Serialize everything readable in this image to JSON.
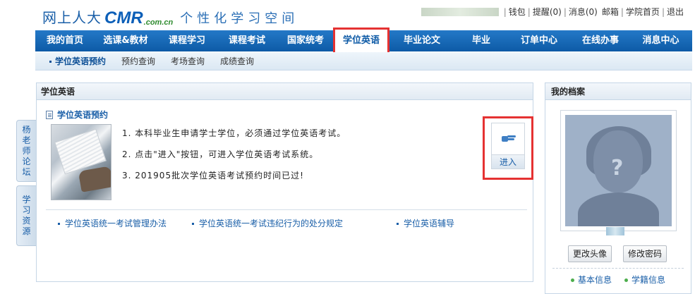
{
  "header": {
    "logo_cn": "网上人大",
    "logo_cmr": "CMR",
    "logo_com": ".com.cn",
    "slogan": "个性化学习空间",
    "toplinks": [
      {
        "label": "钱包"
      },
      {
        "label": "提醒(0)"
      },
      {
        "label": "消息(0)"
      },
      {
        "label": "邮箱"
      },
      {
        "label": "学院首页"
      },
      {
        "label": "退出"
      }
    ]
  },
  "nav": {
    "items": [
      {
        "label": "我的首页"
      },
      {
        "label": "选课&教材"
      },
      {
        "label": "课程学习"
      },
      {
        "label": "课程考试"
      },
      {
        "label": "国家统考"
      },
      {
        "label": "学位英语"
      },
      {
        "label": "毕业论文"
      },
      {
        "label": "毕业"
      },
      {
        "label": "订单中心"
      },
      {
        "label": "在线办事"
      },
      {
        "label": "消息中心"
      }
    ],
    "active_index": 5
  },
  "subnav": {
    "items": [
      {
        "label": "学位英语预约"
      },
      {
        "label": "预约查询"
      },
      {
        "label": "考场查询"
      },
      {
        "label": "成绩查询"
      }
    ]
  },
  "sidetabs": {
    "forum": "杨老师论坛",
    "resources": "学习资源"
  },
  "main": {
    "panel_title": "学位英语",
    "section_title": "学位英语预约",
    "lines": [
      "1. 本科毕业生申请学士学位，必须通过学位英语考试。",
      "2. 点击\"进入\"按钮，可进入学位英语考试系统。",
      "3. 201905批次学位英语考试预约时间已过!"
    ],
    "enter_label": "进入",
    "links": [
      {
        "label": "学位英语统一考试管理办法"
      },
      {
        "label": "学位英语统一考试违纪行为的处分规定"
      },
      {
        "label": "学位英语辅导"
      }
    ]
  },
  "profile": {
    "title": "我的档案",
    "change_avatar": "更改头像",
    "change_password": "修改密码",
    "basic_info": "基本信息",
    "student_info": "学籍信息"
  },
  "colors": {
    "nav_blue": "#0d5aa6",
    "highlight_red": "#e53232",
    "link_blue": "#1a5fa8"
  }
}
